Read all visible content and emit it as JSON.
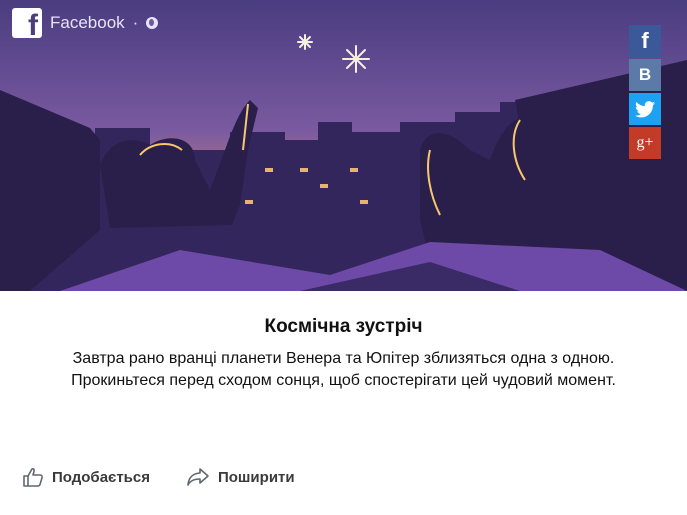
{
  "header": {
    "source_name": "Facebook",
    "separator": "·",
    "fb_letter": "f"
  },
  "share_buttons": [
    {
      "network": "facebook",
      "label": "f",
      "color": "#3b5998"
    },
    {
      "network": "vk",
      "label": "B",
      "color": "#5b7aa8"
    },
    {
      "network": "twitter",
      "icon": "twitter-bird-icon",
      "color": "#1da1f2"
    },
    {
      "network": "google-plus",
      "label": "g+",
      "color": "#c23b27"
    }
  ],
  "post": {
    "title": "Космічна зустріч",
    "description": "Завтра рано вранці планети Венера та Юпітер зблизяться одна з одною. Прокиньтеся перед сходом сонця, щоб спостерігати цей чудовий момент."
  },
  "actions": {
    "like_label": "Подобається",
    "share_label": "Поширити"
  },
  "colors": {
    "sky_top": "#4a3c80",
    "sky_horizon": "#f2a55a",
    "silhouette": "#2a1f4a",
    "accent_line": "#f6c76e"
  }
}
